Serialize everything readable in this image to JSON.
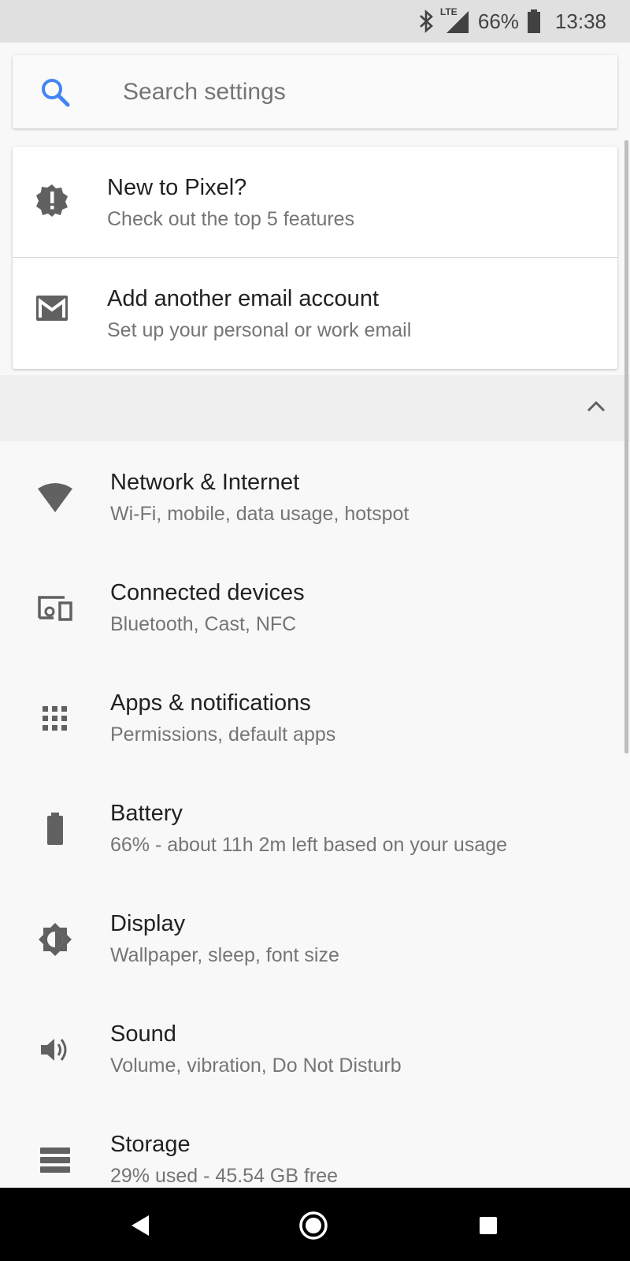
{
  "status_bar": {
    "network_label": "LTE",
    "battery_text": "66%",
    "time": "13:38",
    "icons": [
      "bluetooth-icon",
      "signal-icon",
      "battery-icon"
    ]
  },
  "search": {
    "placeholder": "Search settings",
    "icon": "search-icon",
    "accent_color": "#4285f4"
  },
  "suggestions": [
    {
      "title": "New to Pixel?",
      "subtitle": "Check out the top 5 features",
      "icon": "badge-alert-icon"
    },
    {
      "title": "Add another email account",
      "subtitle": "Set up your personal or work email",
      "icon": "gmail-icon"
    }
  ],
  "collapse": {
    "icon": "chevron-up-icon"
  },
  "settings": [
    {
      "title": "Network & Internet",
      "subtitle": "Wi-Fi, mobile, data usage, hotspot",
      "icon": "wifi-icon"
    },
    {
      "title": "Connected devices",
      "subtitle": "Bluetooth, Cast, NFC",
      "icon": "devices-icon"
    },
    {
      "title": "Apps & notifications",
      "subtitle": "Permissions, default apps",
      "icon": "apps-grid-icon"
    },
    {
      "title": "Battery",
      "subtitle": "66% - about 11h 2m left based on your usage",
      "icon": "battery-icon"
    },
    {
      "title": "Display",
      "subtitle": "Wallpaper, sleep, font size",
      "icon": "brightness-icon"
    },
    {
      "title": "Sound",
      "subtitle": "Volume, vibration, Do Not Disturb",
      "icon": "volume-icon"
    },
    {
      "title": "Storage",
      "subtitle": "29% used - 45.54 GB free",
      "icon": "storage-icon"
    }
  ],
  "nav_bar": {
    "buttons": [
      "back-icon",
      "home-icon",
      "recents-icon"
    ]
  },
  "colors": {
    "icon_gray": "#616161",
    "title_text": "#212121",
    "subtitle_text": "#757575",
    "background": "#f8f8f8"
  }
}
